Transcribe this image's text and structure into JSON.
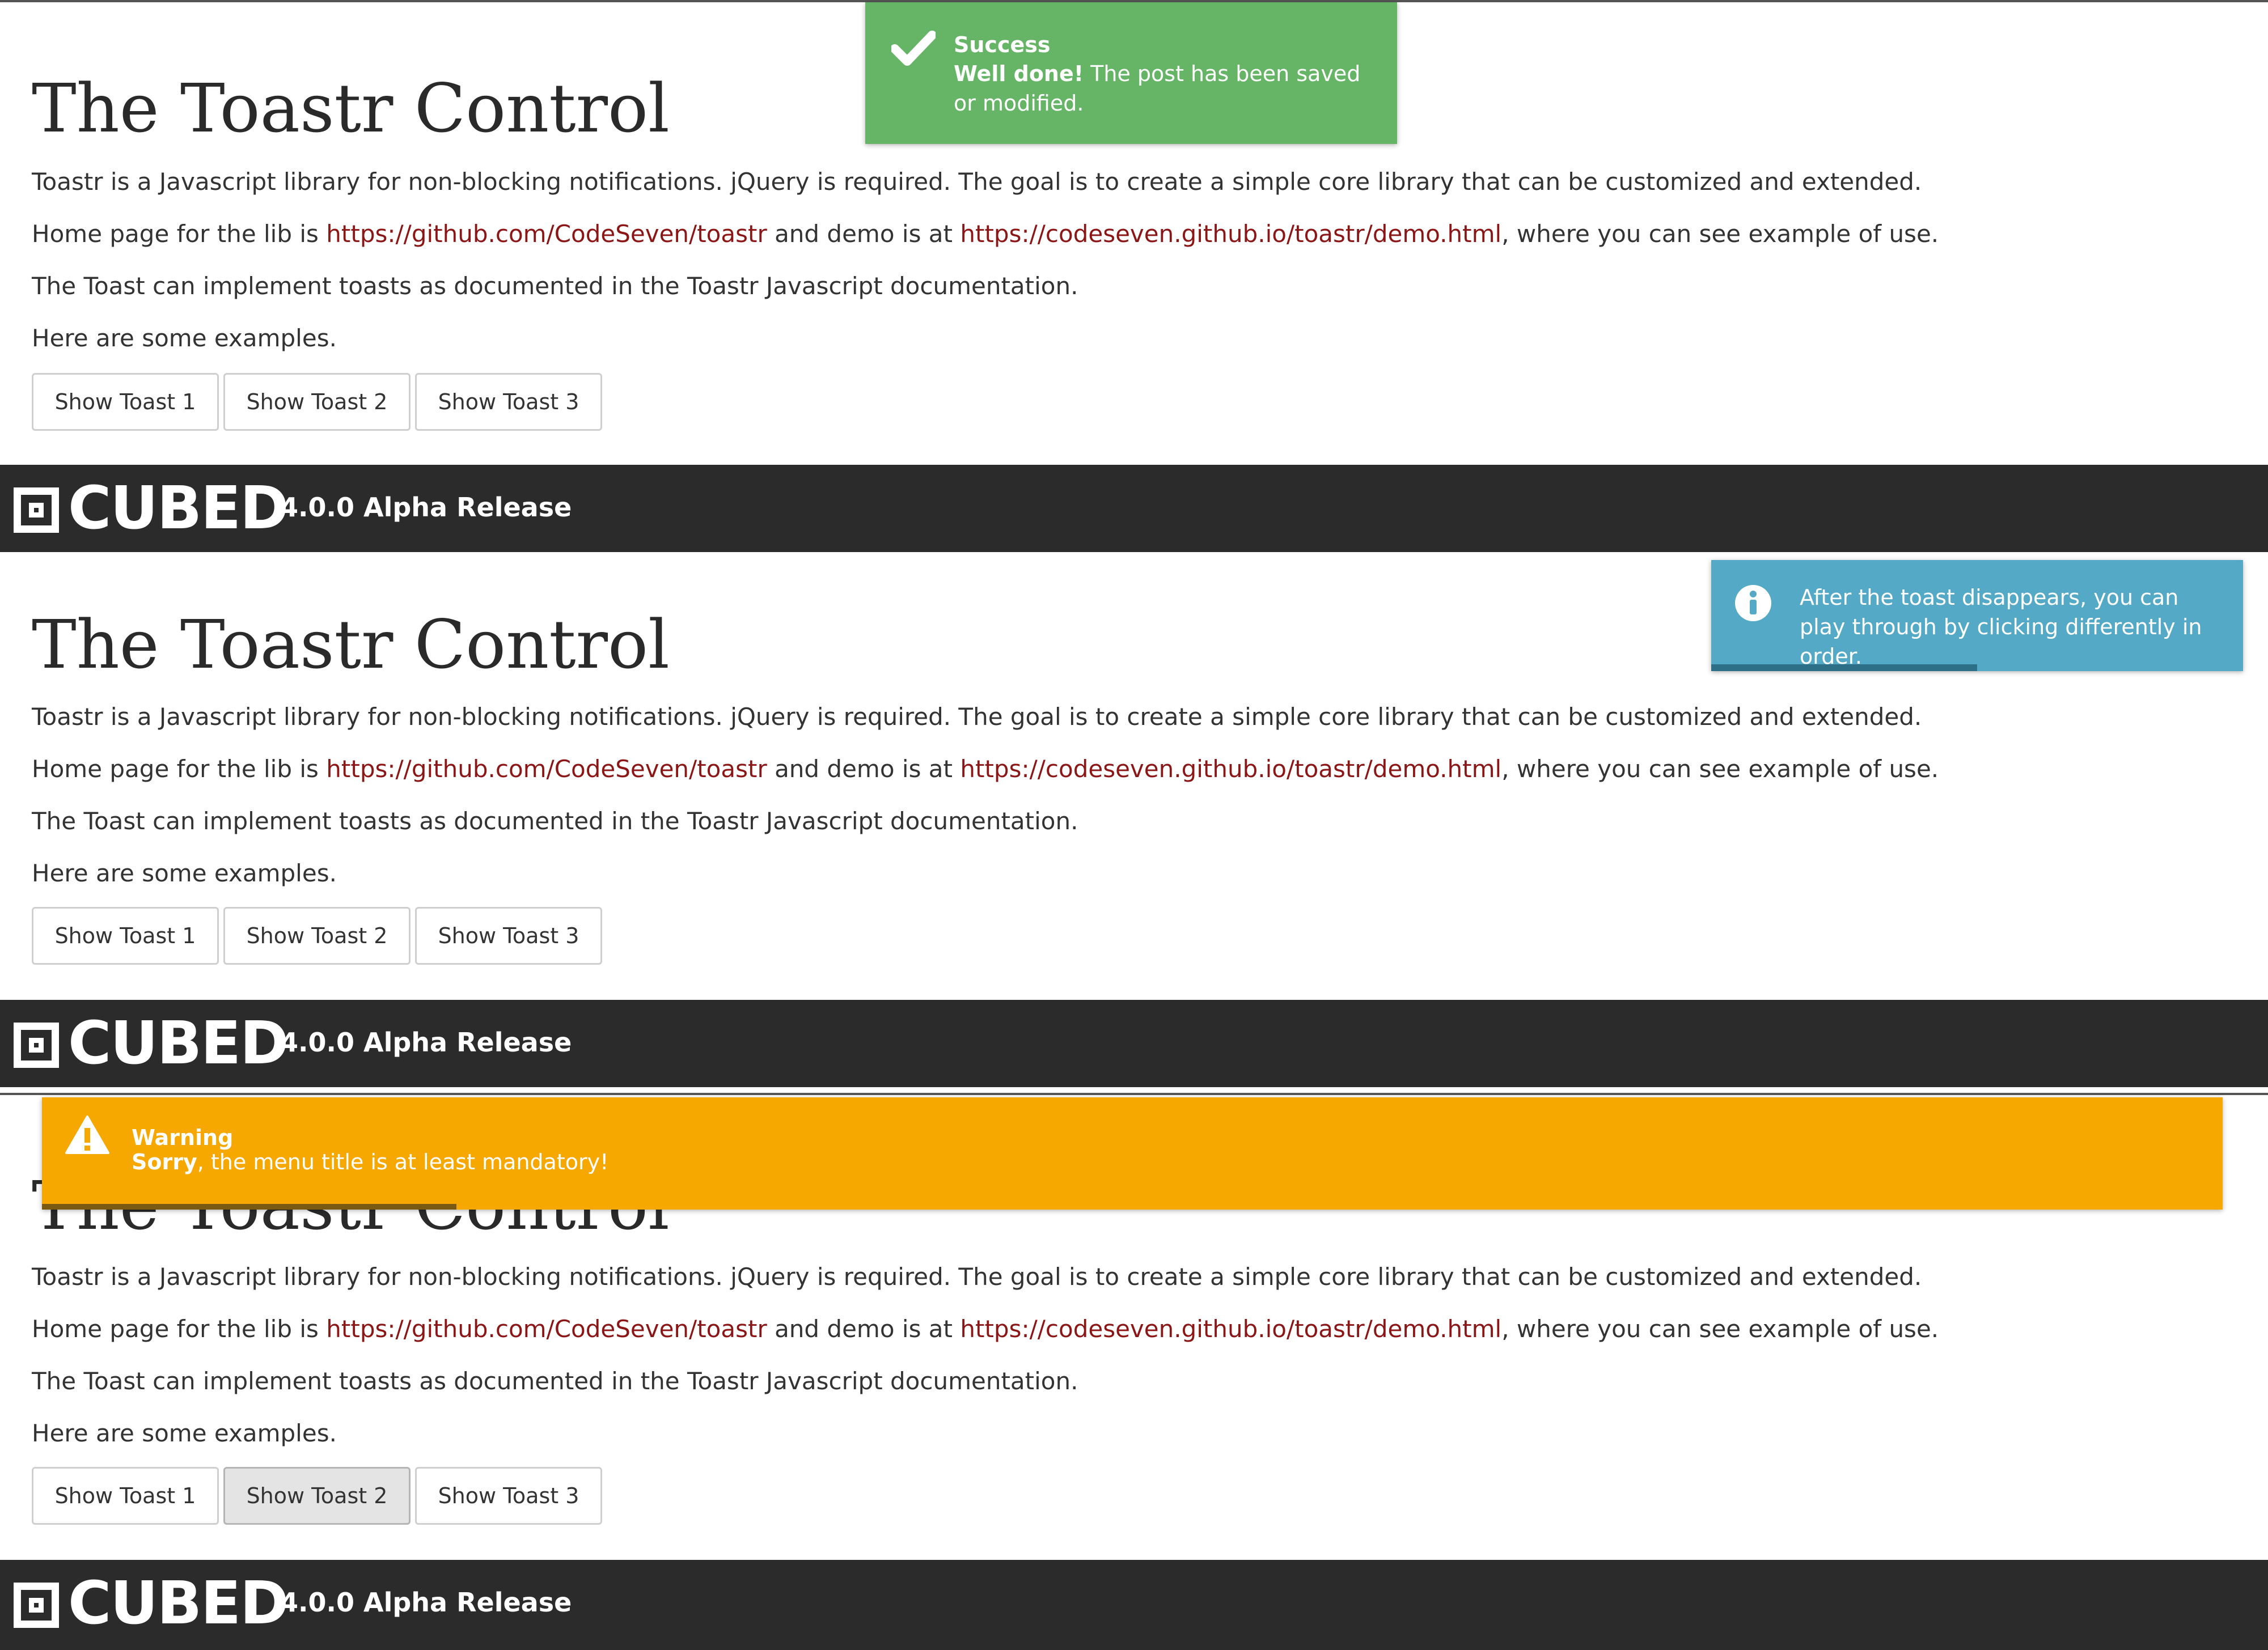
{
  "panels": [
    {
      "title": "The Toastr Control",
      "intro": "Toastr is a Javascript library for non-blocking notifications. jQuery is required. The goal is to create a simple core library that can be customized and extended.",
      "home_prefix": "Home page for the lib is ",
      "home_link": "https://github.com/CodeSeven/toastr",
      "demo_mid": " and demo is at ",
      "demo_link": "https://codeseven.github.io/toastr/demo.html",
      "demo_suffix": ", where you can see example of use.",
      "doc_line": "The Toast can implement toasts as documented in the Toastr Javascript documentation.",
      "examples_line": "Here are some examples.",
      "buttons": [
        "Show Toast 1",
        "Show Toast 2",
        "Show Toast 3"
      ],
      "footer": {
        "logo_text": "CUBED",
        "release": "4.0.0 Alpha Release"
      }
    },
    {
      "title": "The Toastr Control",
      "intro": "Toastr is a Javascript library for non-blocking notifications. jQuery is required. The goal is to create a simple core library that can be customized and extended.",
      "home_prefix": "Home page for the lib is ",
      "home_link": "https://github.com/CodeSeven/toastr",
      "demo_mid": " and demo is at ",
      "demo_link": "https://codeseven.github.io/toastr/demo.html",
      "demo_suffix": ", where you can see example of use.",
      "doc_line": "The Toast can implement toasts as documented in the Toastr Javascript documentation.",
      "examples_line": "Here are some examples.",
      "buttons": [
        "Show Toast 1",
        "Show Toast 2",
        "Show Toast 3"
      ],
      "footer": {
        "logo_text": "CUBED",
        "release": "4.0.0 Alpha Release"
      }
    },
    {
      "title": "The Toastr Control",
      "intro": "Toastr is a Javascript library for non-blocking notifications. jQuery is required. The goal is to create a simple core library that can be customized and extended.",
      "home_prefix": "Home page for the lib is ",
      "home_link": "https://github.com/CodeSeven/toastr",
      "demo_mid": " and demo is at ",
      "demo_link": "https://codeseven.github.io/toastr/demo.html",
      "demo_suffix": ", where you can see example of use.",
      "doc_line": "The Toast can implement toasts as documented in the Toastr Javascript documentation.",
      "examples_line": "Here are some examples.",
      "buttons": [
        "Show Toast 1",
        "Show Toast 2",
        "Show Toast 3"
      ],
      "footer": {
        "logo_text": "CUBED",
        "release": "4.0.0 Alpha Release"
      }
    }
  ],
  "toasts": {
    "success": {
      "title": "Success",
      "message_strong": "Well done!",
      "message": " The post has been saved or modified.",
      "icon": "checkmark-icon",
      "color": "#66b566"
    },
    "info": {
      "message": "After the toast disappears, you can play through by clicking differently in order.",
      "icon": "info-icon",
      "color": "#53a9c6",
      "progress": 0.5
    },
    "warning": {
      "title": "Warning",
      "message_strong": "Sorry",
      "message": ", the menu title is at least mandatory!",
      "icon": "warning-icon",
      "color": "#f6a800",
      "progress": 0.19
    }
  },
  "colors": {
    "link": "#8c1515",
    "footer_bg": "#2b2b2b",
    "active_button": "#e4e4e4"
  },
  "active_button": {
    "panel": 3,
    "label": "Show Toast 2"
  }
}
